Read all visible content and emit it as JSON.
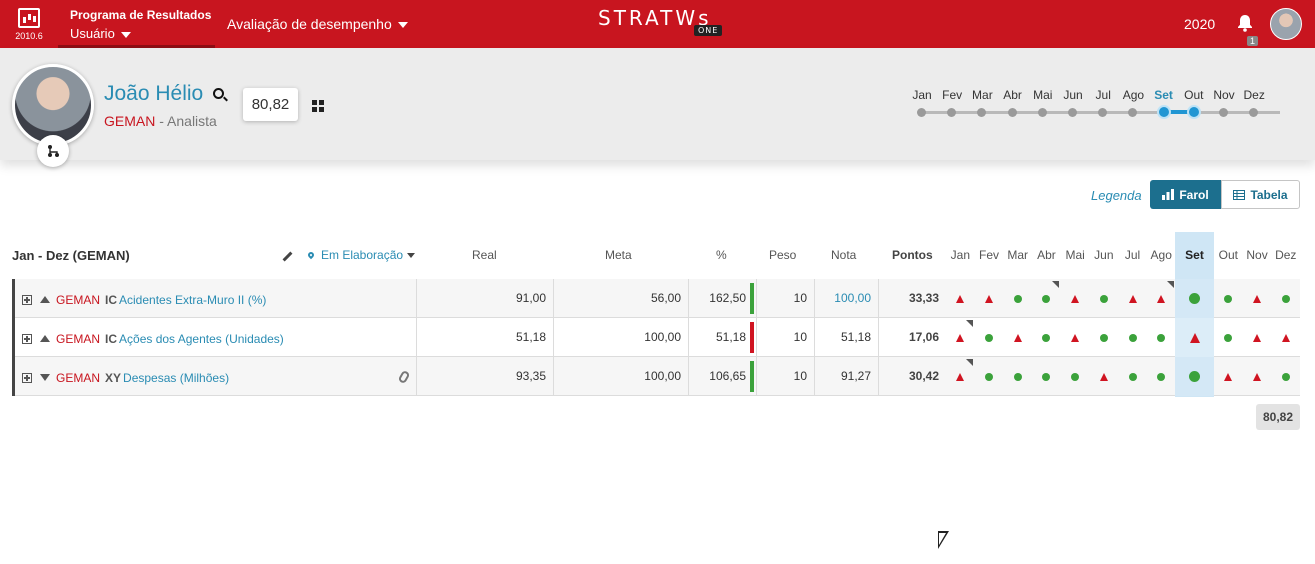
{
  "topbar": {
    "version": "2010.6",
    "program_title": "Programa de Resultados",
    "program_user": "Usuário",
    "menu_label": "Avaliação de desempenho",
    "logo_text": "STRATWs",
    "logo_badge": "ONE",
    "year": "2020",
    "notification_count": "1",
    "bell_icon": "bell-icon"
  },
  "profile": {
    "name": "João Hélio",
    "org": "GEMAN",
    "separator": "-",
    "role": "Analista",
    "score": "80,82"
  },
  "months": [
    "Jan",
    "Fev",
    "Mar",
    "Abr",
    "Mai",
    "Jun",
    "Jul",
    "Ago",
    "Set",
    "Out",
    "Nov",
    "Dez"
  ],
  "selected_month": "Set",
  "toolbar": {
    "legend": "Legenda",
    "farol": "Farol",
    "tabela": "Tabela"
  },
  "table": {
    "period": "Jan - Dez (GEMAN)",
    "status": "Em Elaboração",
    "headers": {
      "real": "Real",
      "meta": "Meta",
      "pct": "%",
      "peso": "Peso",
      "nota": "Nota",
      "pontos": "Pontos"
    },
    "rows": [
      {
        "org": "GEMAN",
        "type": "IC",
        "name": "Acidentes Extra-Muro II (%)",
        "real": "91,00",
        "meta": "56,00",
        "pct": "162,50",
        "peso": "10",
        "nota": "100,00",
        "pontos": "33,33",
        "bar": "#3ba23b",
        "marks": [
          "tri",
          "tri",
          "dot",
          "dot",
          "tri",
          "dot",
          "tri",
          "tri",
          "dot",
          "dot",
          "tri",
          "dot"
        ],
        "flags": [
          3,
          7
        ]
      },
      {
        "org": "GEMAN",
        "type": "IC",
        "name": "Ações dos Agentes (Unidades)",
        "real": "51,18",
        "meta": "100,00",
        "pct": "51,18",
        "peso": "10",
        "nota": "51,18",
        "pontos": "17,06",
        "bar": "#d01421",
        "marks": [
          "tri",
          "dot",
          "tri",
          "dot",
          "tri",
          "dot",
          "dot",
          "dot",
          "tri",
          "dot",
          "tri",
          "tri"
        ],
        "flags": [
          0
        ]
      },
      {
        "org": "GEMAN",
        "type": "XY",
        "name": "Despesas (Milhões)",
        "real": "93,35",
        "meta": "100,00",
        "pct": "106,65",
        "peso": "10",
        "nota": "91,27",
        "pontos": "30,42",
        "bar": "#3ba23b",
        "marks": [
          "tri",
          "dot",
          "dot",
          "dot",
          "dot",
          "tri",
          "dot",
          "dot",
          "dot",
          "tri",
          "tri",
          "dot"
        ],
        "flags": [
          0
        ]
      }
    ],
    "total": "80,82"
  },
  "colors": {
    "brand": "#c8151f",
    "accent": "#2a8cb3",
    "good": "#3ba23b",
    "bad": "#d01421"
  }
}
